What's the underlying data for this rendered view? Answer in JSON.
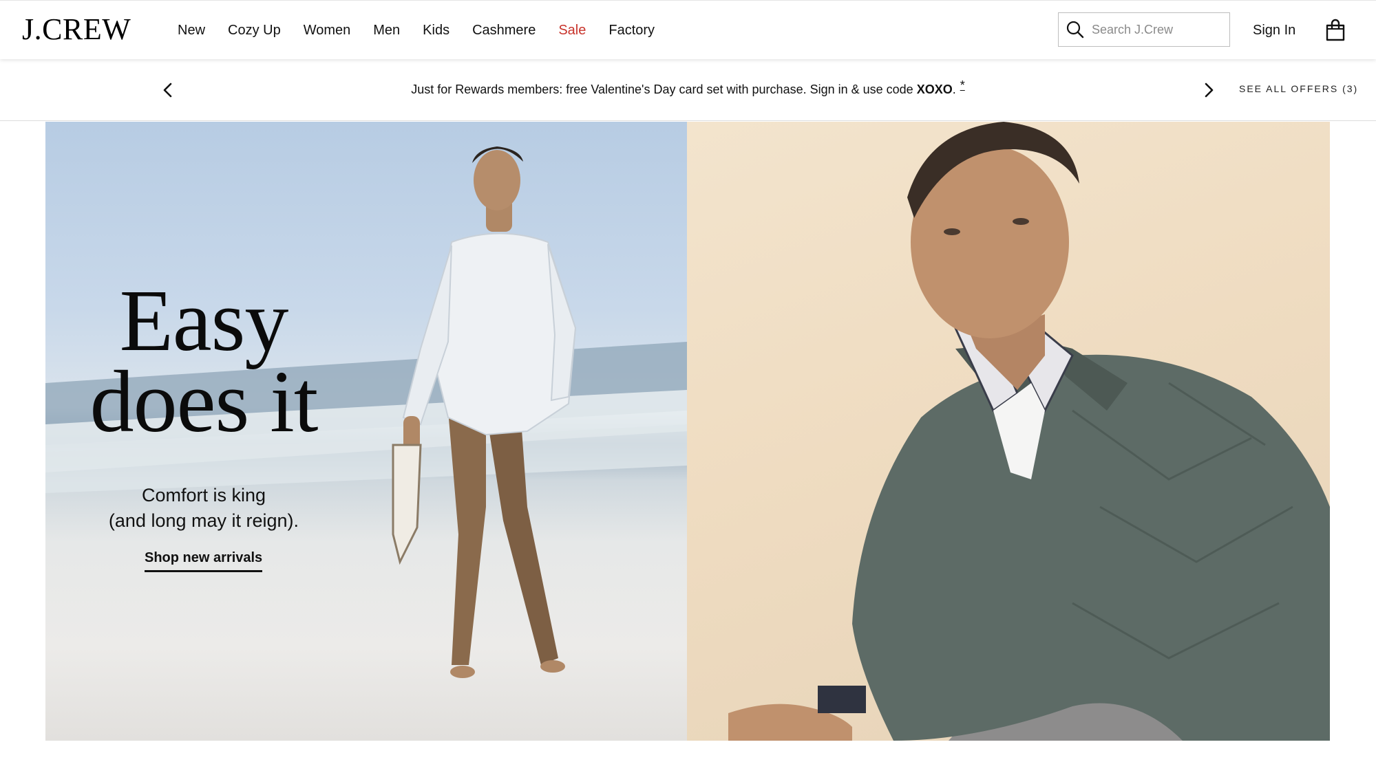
{
  "header": {
    "logo": "J.CREW",
    "nav": [
      {
        "label": "New"
      },
      {
        "label": "Cozy Up"
      },
      {
        "label": "Women"
      },
      {
        "label": "Men"
      },
      {
        "label": "Kids"
      },
      {
        "label": "Cashmere"
      },
      {
        "label": "Sale"
      },
      {
        "label": "Factory"
      }
    ],
    "search": {
      "placeholder": "Search J.Crew",
      "icon": "search-icon"
    },
    "sign_in": "Sign In",
    "bag_icon": "shopping-bag-icon",
    "sale_color": "#c8342c"
  },
  "promo": {
    "text": "Just for Rewards members: free Valentine's Day card set with purchase. Sign in & use code ",
    "code": "XOXO",
    "trailing": ".",
    "asterisk": "*",
    "see_all": "SEE ALL OFFERS (3)",
    "prev_icon": "chevron-left-icon",
    "next_icon": "chevron-right-icon"
  },
  "hero": {
    "headline_line1": "Easy",
    "headline_line2": "does it",
    "subhead_line1": "Comfort is king",
    "subhead_line2": "(and long may it reign).",
    "cta": "Shop new arrivals"
  }
}
